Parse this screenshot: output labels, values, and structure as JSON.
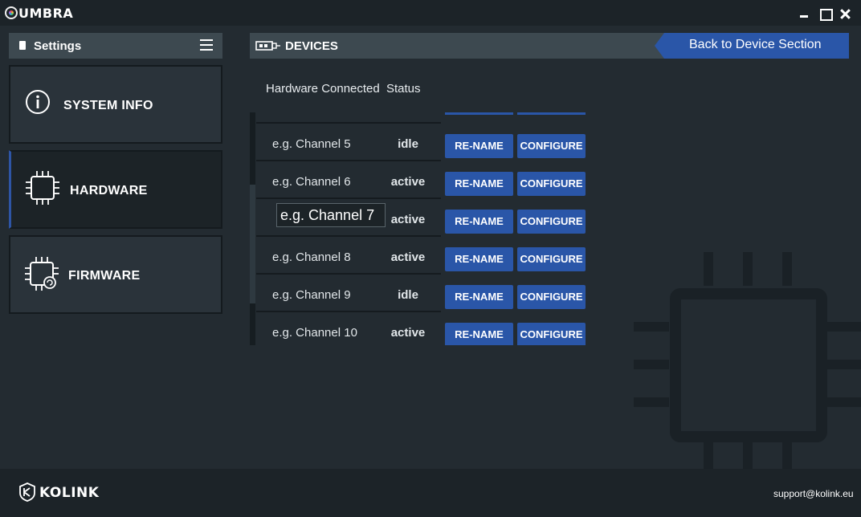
{
  "app": {
    "title": "UMBRA"
  },
  "window_controls": [
    "minimize",
    "maximize",
    "close"
  ],
  "sidebar": {
    "header": "Settings",
    "items": [
      {
        "label": "SYSTEM INFO",
        "icon": "info-icon",
        "active": false
      },
      {
        "label": "HARDWARE",
        "icon": "chip-icon",
        "active": true
      },
      {
        "label": "FIRMWARE",
        "icon": "chip-refresh-icon",
        "active": false
      }
    ]
  },
  "devices": {
    "title": "DEVICES",
    "back_button": "Back to Device Section",
    "columns": {
      "hardware": "Hardware Connected",
      "status": "Status"
    },
    "rename_label": "RE-NAME",
    "configure_label": "CONFIGURE",
    "rows": [
      {
        "name": "e.g. Channel 5",
        "status": "idle",
        "editing": false
      },
      {
        "name": "e.g. Channel 6",
        "status": "active",
        "editing": false
      },
      {
        "name": "e.g. Channel 7",
        "status": "active",
        "editing": true
      },
      {
        "name": "e.g. Channel 8",
        "status": "active",
        "editing": false
      },
      {
        "name": "e.g. Channel 9",
        "status": "idle",
        "editing": false
      },
      {
        "name": "e.g. Channel 10",
        "status": "active",
        "editing": false
      }
    ]
  },
  "footer": {
    "brand": "KOLINK",
    "support_email": "support@kolink.eu"
  },
  "colors": {
    "accent": "#2a56a8",
    "panel": "#3d4950",
    "background": "#232b31",
    "bar": "#1c2328"
  }
}
